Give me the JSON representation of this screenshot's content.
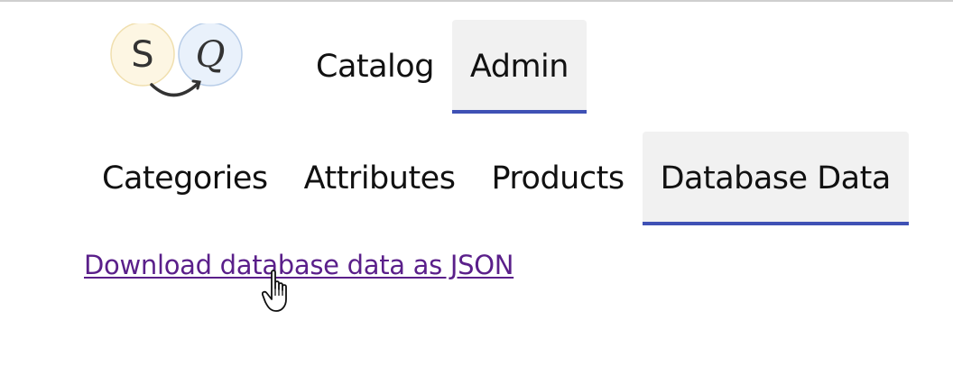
{
  "logo": {
    "letter_left": "S",
    "letter_right": "Q"
  },
  "main_nav": {
    "items": [
      {
        "label": "Catalog",
        "active": false
      },
      {
        "label": "Admin",
        "active": true
      }
    ]
  },
  "sub_nav": {
    "items": [
      {
        "label": "Categories",
        "active": false
      },
      {
        "label": "Attributes",
        "active": false
      },
      {
        "label": "Products",
        "active": false
      },
      {
        "label": "Database Data",
        "active": true
      }
    ]
  },
  "content": {
    "download_link": "Download database data as JSON"
  },
  "colors": {
    "active_tab_background": "#f1f1f1",
    "active_tab_underline": "#3f51b5",
    "visited_link": "#5a1f8a"
  },
  "icons": {
    "cursor": "hand-pointer-icon"
  }
}
